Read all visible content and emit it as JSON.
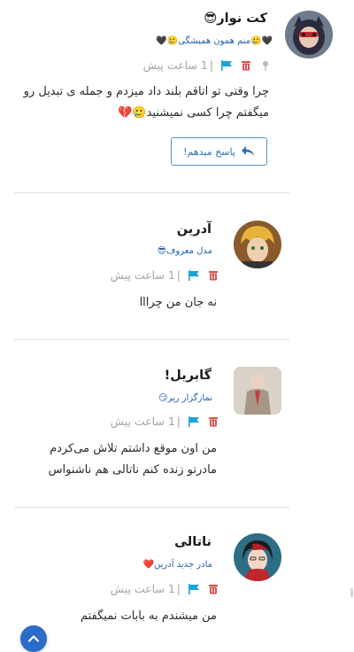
{
  "comments": [
    {
      "name": "کت نوار😎",
      "subtitle": "🖤🥲منم همون همیشگی🥲🖤",
      "time": "1 ساعت پیش",
      "text_lines": [
        "چرا وقتی تو اتاقم بلند داد میزدم و جمله ی تبدیل رو",
        "میگفتم چرا کسی نمیشنید🥲💔"
      ],
      "reply_label": "پاسخ میدهم!"
    },
    {
      "name": "آدرین",
      "subtitle": "مدل معروف😎",
      "time": "1 ساعت پیش",
      "text_lines": [
        "نه جان من چرااا"
      ]
    },
    {
      "name": "گابریل!",
      "subtitle": "نمازگزار ریر😏",
      "time": "1 ساعت پیش",
      "text_lines": [
        "من اون موقع داشتم تلاش می‌کردم",
        "مادرتو زنده کنم ناتالی هم ناشنواس"
      ]
    },
    {
      "name": "ناتالی",
      "subtitle": "مادر جدید آدرین❤️",
      "time": "1 ساعت پیش",
      "text_lines": [
        "من میشندم به بابات نمیگفتم"
      ]
    }
  ],
  "time_separator": "|",
  "icons": {
    "flag": "flag-icon",
    "delete": "trash-icon",
    "pin": "pin-icon",
    "reply": "reply-arrow-icon",
    "scroll_top": "chevron-up-icon"
  },
  "colors": {
    "flag": "#1aa3d9",
    "delete": "#d9534f",
    "pin": "#b8b8b8",
    "subtitle": "#1f5fb0",
    "scroll_button": "#2a6cc7"
  }
}
